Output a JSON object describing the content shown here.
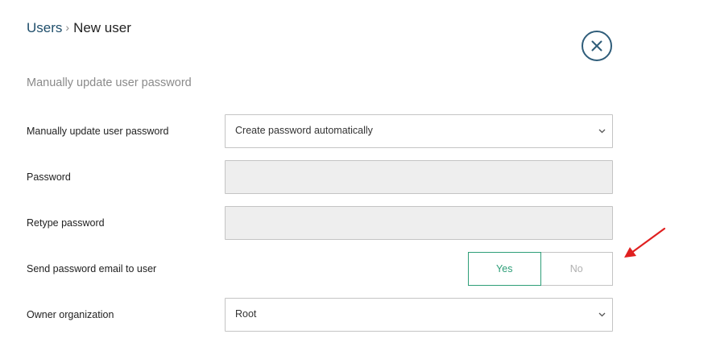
{
  "breadcrumb": {
    "parent": "Users",
    "separator": "›",
    "current": "New user"
  },
  "close_icon": "close-icon",
  "section_title": "Manually update user password",
  "fields": {
    "password_mode": {
      "label": "Manually update user password",
      "value": "Create password automatically"
    },
    "password": {
      "label": "Password",
      "value": "",
      "disabled": true
    },
    "retype_password": {
      "label": "Retype password",
      "value": "",
      "disabled": true
    },
    "send_email": {
      "label": "Send password email to user",
      "yes_label": "Yes",
      "no_label": "No",
      "selected": "Yes"
    },
    "owner_org": {
      "label": "Owner organization",
      "value": "Root"
    }
  },
  "colors": {
    "link": "#1f4e6b",
    "close_border": "#2f5d7a",
    "toggle_active": "#2e9e78",
    "annotation_arrow": "#e02020",
    "disabled_bg": "#eeeeee"
  }
}
